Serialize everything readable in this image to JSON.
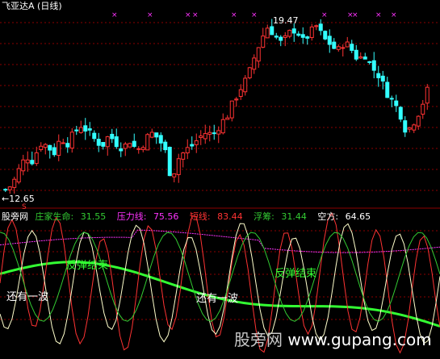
{
  "stock": {
    "title": "飞亚达A (日线)",
    "high_label": "19.47",
    "low_label": "←12.65",
    "signal_mark": "S"
  },
  "indicator": {
    "name": "股旁网",
    "items": [
      {
        "label": "庄家生命:",
        "value": "31.55",
        "color": "#33cc33"
      },
      {
        "label": "压力线:",
        "value": "75.56",
        "color": "#ff33ff"
      },
      {
        "label": "短线:",
        "value": "83.44",
        "color": "#ff3333"
      },
      {
        "label": "浮筹:",
        "value": "31.44",
        "color": "#33cc33"
      },
      {
        "label": "空方:",
        "value": "64.65",
        "color": "#ffffff"
      }
    ]
  },
  "annotations": {
    "rebound_end": "反弹结束",
    "one_more_wave": "还有一波"
  },
  "watermark": {
    "site_cn": "股旁网",
    "site_url": "www.gupang.com"
  },
  "colors": {
    "up": "#ff3333",
    "down": "#33ffff",
    "grid": "#8b0000",
    "green": "#33ff33",
    "magenta": "#ff33ff"
  },
  "chart_data": [
    {
      "type": "candlestick",
      "title": "飞亚达A (日线)",
      "y_range": [
        12.65,
        19.47
      ],
      "high_marker": 19.47,
      "low_marker": 12.65,
      "close_path": [
        12.8,
        13.0,
        13.6,
        14.1,
        13.9,
        14.6,
        14.5,
        14.2,
        14.8,
        14.6,
        15.0,
        15.3,
        15.0,
        14.7,
        14.5,
        14.9,
        14.6,
        14.4,
        14.7,
        14.3,
        14.6,
        15.0,
        14.8,
        14.4,
        13.2,
        14.0,
        14.3,
        14.5,
        14.8,
        15.0,
        14.9,
        15.3,
        15.6,
        16.2,
        16.7,
        17.1,
        17.9,
        18.6,
        19.1,
        18.7,
        18.4,
        18.8,
        19.0,
        18.5,
        18.8,
        19.1,
        18.6,
        18.4,
        18.1,
        18.5,
        18.2,
        17.8,
        18.0,
        17.5,
        17.2,
        16.6,
        16.2,
        15.8,
        15.0,
        15.4,
        15.9,
        16.6
      ]
    },
    {
      "type": "line",
      "series": [
        {
          "name": "庄家生命",
          "last": 31.55
        },
        {
          "name": "压力线",
          "last": 75.56
        },
        {
          "name": "短线",
          "last": 83.44
        },
        {
          "name": "浮筹",
          "last": 31.44
        },
        {
          "name": "空方",
          "last": 64.65
        }
      ]
    }
  ]
}
